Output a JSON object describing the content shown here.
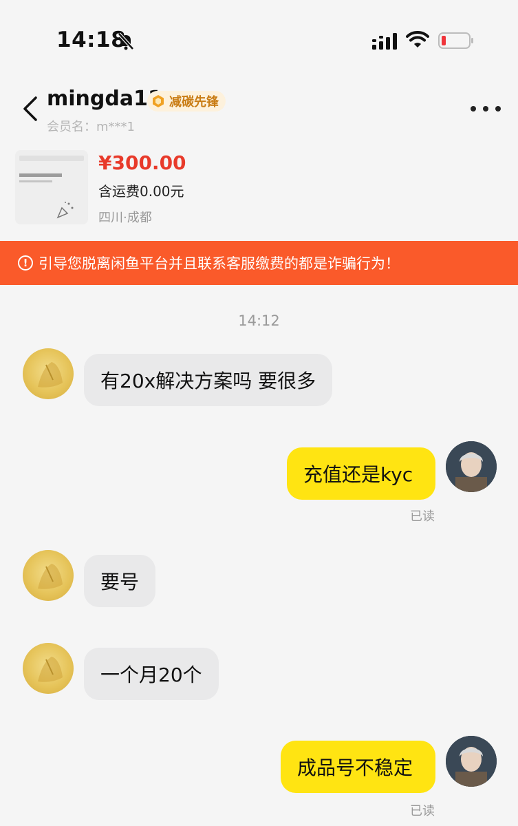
{
  "status_bar": {
    "time": "14:18",
    "icons": [
      "bell-off-icon",
      "signal-icon",
      "wifi-icon",
      "battery-low-icon"
    ]
  },
  "header": {
    "seller_name": "mingda11",
    "badge": "减碳先锋",
    "member_label": "会员名：",
    "member_value": "m***1"
  },
  "product": {
    "price": "¥300.00",
    "shipping": "含运费0.00元",
    "location": "四川·成都",
    "thumb_text": "恭喜你，你已经完成了！"
  },
  "warning": {
    "text": "引导您脱离闲鱼平台并且联系客服缴费的都是诈骗行为！"
  },
  "chat": {
    "timestamp": "14:12",
    "messages": [
      {
        "side": "in",
        "text": "有20x解决方案吗 要很多"
      },
      {
        "side": "out",
        "text": "充值还是kyc",
        "status": "已读"
      },
      {
        "side": "in",
        "text": "要号"
      },
      {
        "side": "in",
        "text": "一个月20个"
      },
      {
        "side": "out",
        "text": "成品号不稳定",
        "status": "已读"
      }
    ]
  },
  "colors": {
    "price": "#e83a2a",
    "warning_bg": "#fa5a2a",
    "outgoing_bubble": "#ffe412",
    "incoming_bubble": "#e9e9ea",
    "badge_text": "#c97c14"
  }
}
